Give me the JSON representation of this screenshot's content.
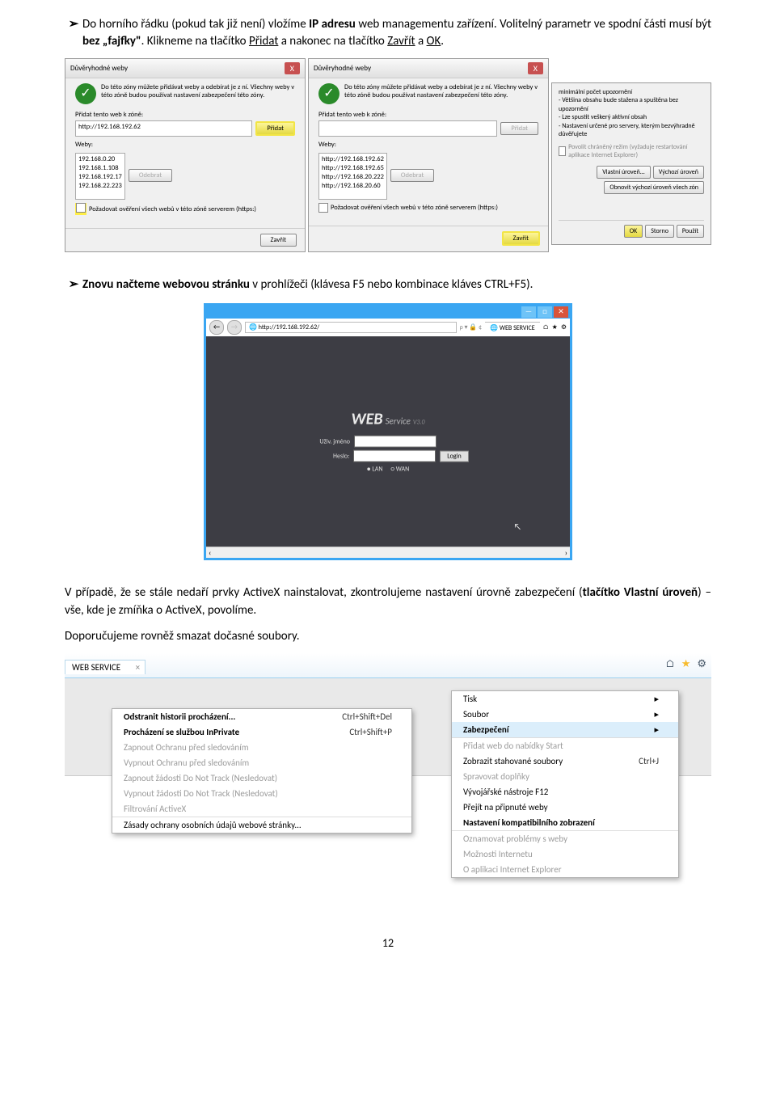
{
  "bullet1": {
    "pre": "Do horního řádku (pokud tak již není) vložíme ",
    "b1": "IP adresu",
    "mid1": " web managementu zařízení. Volitelný parametr ve spodní části musí být ",
    "b2": "bez „fajfky\"",
    "mid2": ". Klikneme na tlačítko ",
    "u1": "Přidat",
    "mid3": " a nakonec na tlačítko ",
    "u2": "Zavřít",
    "mid4": " a ",
    "u3": "OK",
    "end": "."
  },
  "dialogs": {
    "title": "Důvěryhodné weby",
    "info": "Do této zóny můžete přidávat weby a odebírat je z ní. Všechny weby v této zóně budou používat nastavení zabezpečení této zóny.",
    "addlabel": "Přidat tento web k zóně:",
    "webslabel": "Weby:",
    "btn_add": "Přidat",
    "btn_remove": "Odebrat",
    "btn_close": "Zavřít",
    "chk": "Požadovat ověření všech webů v této zóně serverem (https:)",
    "left": {
      "input": "http://192.168.192.62",
      "list": [
        "192.168.0.20",
        "192.168.1.108",
        "192.168.192.17",
        "192.168.22.223"
      ]
    },
    "right": {
      "input": "",
      "list": [
        "http://192.168.192.62",
        "http://192.168.192.65",
        "http://192.168.20.222",
        "http://192.168.20.60"
      ]
    }
  },
  "secpane": {
    "items": [
      "   minimální počet upozornění",
      "- Většina obsahu bude stažena a spuštěna bez upozornění",
      "- Lze spustit veškerý aktivní obsah",
      "- Nastavení určené pro servery, kterým bezvýhradně důvěřujete"
    ],
    "chk": "Povolit chráněný režim (vyžaduje restartování aplikace Internet Explorer)",
    "btn_vl": "Vlastní úroveň...",
    "btn_vy": "Výchozí úroveň",
    "btn_obn": "Obnovit výchozí úroveň všech zón",
    "btn_ok": "OK",
    "btn_st": "Storno",
    "btn_pz": "Použít"
  },
  "bullet2": {
    "b": "Znovu načteme webovou stránku",
    "rest": " v prohlížeči (klávesa F5 nebo kombinace kláves CTRL+F5)."
  },
  "ws": {
    "url": "http://192.168.192.62/",
    "tab": "WEB SERVICE",
    "logo_w": "WEB",
    "logo_s": "Service",
    "logo_v": "V3.0",
    "lbl_user": "Uživ. jméno",
    "lbl_pass": "Heslo:",
    "btn_login": "Login",
    "r_lan": "● LAN",
    "r_wan": "○ WAN"
  },
  "para2": {
    "t1": "V případě, že se stále nedaří prvky ActiveX nainstalovat, zkontrolujeme nastavení úrovně zabezpečení (",
    "b1": "tlačítko Vlastní úroveň",
    "t2": ") – vše, kde je zmíňka o ActiveX, povolíme."
  },
  "para3": "Doporučujeme rovněž smazat dočasné soubory.",
  "ie": {
    "tab": "WEB SERVICE",
    "menuL": [
      {
        "t": "Odstranit historii procházení...",
        "s": "Ctrl+Shift+Del",
        "b": true
      },
      {
        "t": "Procházení se službou InPrivate",
        "s": "Ctrl+Shift+P",
        "b": true
      },
      {
        "t": "Zapnout Ochranu před sledováním",
        "d": true
      },
      {
        "t": "Vypnout Ochranu před sledováním",
        "d": true
      },
      {
        "t": "Zapnout žádosti Do Not Track (Nesledovat)",
        "d": true
      },
      {
        "t": "Vypnout žádosti Do Not Track (Nesledovat)",
        "d": true
      },
      {
        "t": "Filtrování ActiveX",
        "d": true
      },
      {
        "t": "Zásady ochrany osobních údajů webové stránky...",
        "sep": true
      }
    ],
    "menuR": [
      {
        "t": "Tisk",
        "arr": true
      },
      {
        "t": "Soubor",
        "arr": true
      },
      {
        "t": "Zabezpečení",
        "arr": true,
        "hov": true,
        "b": true
      },
      {
        "t": "Přidat web do nabídky Start",
        "d": true,
        "sep": true
      },
      {
        "t": "Zobrazit stahované soubory",
        "s": "Ctrl+J"
      },
      {
        "t": "Spravovat doplňky",
        "d": true
      },
      {
        "t": "Vývojářské nástroje F12"
      },
      {
        "t": "Přejít na připnuté weby"
      },
      {
        "t": "Nastavení kompatibilního zobrazení",
        "b": true
      },
      {
        "t": "Oznamovat problémy s weby",
        "d": true,
        "sep": true
      },
      {
        "t": "Možnosti Internetu",
        "d": true
      },
      {
        "t": "O aplikaci Internet Explorer",
        "d": true
      }
    ]
  },
  "pagenum": "12"
}
